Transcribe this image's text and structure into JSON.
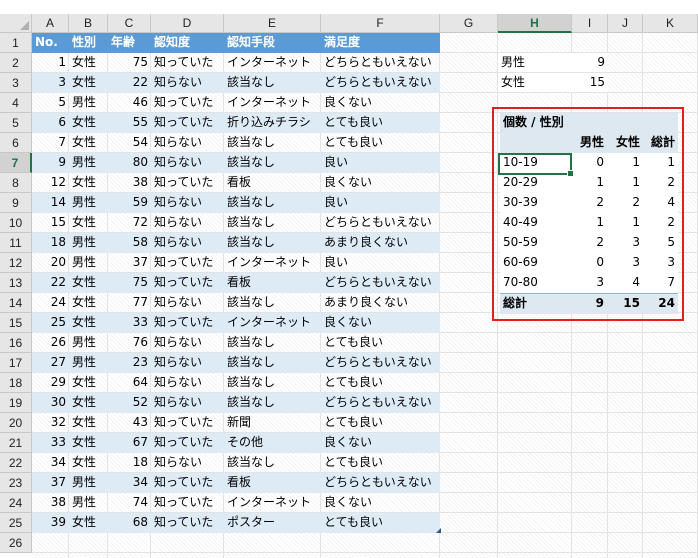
{
  "columns": [
    "A",
    "B",
    "C",
    "D",
    "E",
    "F",
    "G",
    "H",
    "I",
    "J",
    "K"
  ],
  "selected_column": "H",
  "selected_row": 7,
  "rows": [
    "1",
    "2",
    "3",
    "4",
    "5",
    "6",
    "7",
    "8",
    "9",
    "10",
    "11",
    "12",
    "13",
    "14",
    "15",
    "16",
    "17",
    "18",
    "19",
    "20",
    "21",
    "22",
    "23",
    "24",
    "25",
    "26"
  ],
  "table": {
    "headers": [
      "No.",
      "性別",
      "年齢",
      "認知度",
      "認知手段",
      "満足度"
    ],
    "records": [
      [
        "1",
        "女性",
        "75",
        "知っていた",
        "インターネット",
        "どちらともいえない"
      ],
      [
        "3",
        "女性",
        "22",
        "知らない",
        "該当なし",
        "どちらともいえない"
      ],
      [
        "5",
        "男性",
        "46",
        "知っていた",
        "インターネット",
        "良くない"
      ],
      [
        "6",
        "女性",
        "55",
        "知っていた",
        "折り込みチラシ",
        "とても良い"
      ],
      [
        "7",
        "女性",
        "54",
        "知らない",
        "該当なし",
        "とても良い"
      ],
      [
        "9",
        "男性",
        "80",
        "知らない",
        "該当なし",
        "良い"
      ],
      [
        "12",
        "女性",
        "38",
        "知っていた",
        "看板",
        "良くない"
      ],
      [
        "14",
        "男性",
        "59",
        "知らない",
        "該当なし",
        "良い"
      ],
      [
        "15",
        "女性",
        "72",
        "知らない",
        "該当なし",
        "どちらともいえない"
      ],
      [
        "18",
        "男性",
        "58",
        "知らない",
        "該当なし",
        "あまり良くない"
      ],
      [
        "20",
        "男性",
        "37",
        "知っていた",
        "インターネット",
        "良い"
      ],
      [
        "22",
        "女性",
        "75",
        "知っていた",
        "看板",
        "どちらともいえない"
      ],
      [
        "24",
        "女性",
        "77",
        "知らない",
        "該当なし",
        "あまり良くない"
      ],
      [
        "25",
        "女性",
        "33",
        "知っていた",
        "インターネット",
        "良くない"
      ],
      [
        "26",
        "男性",
        "76",
        "知らない",
        "該当なし",
        "とても良い"
      ],
      [
        "27",
        "男性",
        "23",
        "知らない",
        "該当なし",
        "どちらともいえない"
      ],
      [
        "29",
        "女性",
        "64",
        "知らない",
        "該当なし",
        "とても良い"
      ],
      [
        "30",
        "女性",
        "52",
        "知らない",
        "該当なし",
        "どちらともいえない"
      ],
      [
        "32",
        "女性",
        "43",
        "知っていた",
        "新聞",
        "とても良い"
      ],
      [
        "33",
        "女性",
        "67",
        "知っていた",
        "その他",
        "良くない"
      ],
      [
        "34",
        "女性",
        "18",
        "知らない",
        "該当なし",
        "とても良い"
      ],
      [
        "37",
        "男性",
        "34",
        "知っていた",
        "看板",
        "どちらともいえない"
      ],
      [
        "38",
        "男性",
        "74",
        "知っていた",
        "インターネット",
        "良くない"
      ],
      [
        "39",
        "女性",
        "68",
        "知っていた",
        "ポスター",
        "とても良い"
      ]
    ]
  },
  "counts": [
    {
      "label": "男性",
      "value": "9"
    },
    {
      "label": "女性",
      "value": "15"
    }
  ],
  "pivot": {
    "title": "個数 / 性別",
    "headers": [
      "男性",
      "女性",
      "総計"
    ],
    "rows": [
      {
        "label": "10-19",
        "values": [
          "0",
          "1",
          "1"
        ]
      },
      {
        "label": "20-29",
        "values": [
          "1",
          "1",
          "2"
        ]
      },
      {
        "label": "30-39",
        "values": [
          "2",
          "2",
          "4"
        ]
      },
      {
        "label": "40-49",
        "values": [
          "1",
          "1",
          "2"
        ]
      },
      {
        "label": "50-59",
        "values": [
          "2",
          "3",
          "5"
        ]
      },
      {
        "label": "60-69",
        "values": [
          "0",
          "3",
          "3"
        ]
      },
      {
        "label": "70-80",
        "values": [
          "3",
          "4",
          "7"
        ]
      }
    ],
    "total": {
      "label": "総計",
      "values": [
        "9",
        "15",
        "24"
      ]
    }
  },
  "colors": {
    "header_fill": "#5b9bd5",
    "band_fill": "#ddebf7",
    "pivot_fill": "#dde8f1",
    "highlight_border": "#e01f1f",
    "selection": "#217346"
  }
}
